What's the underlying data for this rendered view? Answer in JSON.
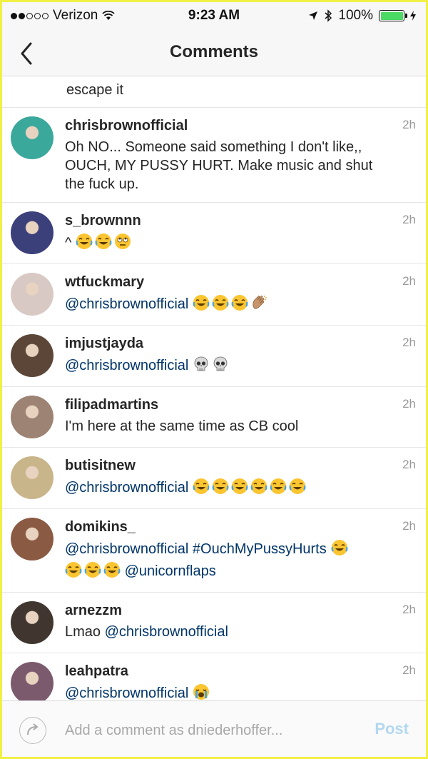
{
  "status_bar": {
    "carrier": "Verizon",
    "time": "9:23 AM",
    "battery": "100%",
    "battery_level": 1.0
  },
  "nav": {
    "title": "Comments"
  },
  "partial_comment": {
    "text": "escape it"
  },
  "comments": [
    {
      "username": "chrisbrownofficial",
      "text": "Oh NO... Someone said something I don't like,, OUCH, MY PUSSY HURT. Make music and shut the fuck up.",
      "time": "2h",
      "avatar_color": "#3aa89b"
    },
    {
      "username": "s_brownnn",
      "text": "^",
      "emojis": [
        "joy",
        "joy",
        "eye-roll"
      ],
      "time": "2h",
      "avatar_color": "#3b3f7a"
    },
    {
      "username": "wtfuckmary",
      "mention": "@chrisbrownofficial",
      "emojis": [
        "joy",
        "joy",
        "joy",
        "clap"
      ],
      "time": "2h",
      "avatar_color": "#d8c9c4"
    },
    {
      "username": "imjustjayda",
      "mention": "@chrisbrownofficial",
      "emojis": [
        "skull",
        "skull"
      ],
      "time": "2h",
      "avatar_color": "#5b4638"
    },
    {
      "username": "filipadmartins",
      "text": "I'm here at the same time as CB cool",
      "time": "2h",
      "avatar_color": "#9c8373"
    },
    {
      "username": "butisitnew",
      "mention": "@chrisbrownofficial",
      "emojis": [
        "joy",
        "joy",
        "joy",
        "joy",
        "joy",
        "joy"
      ],
      "time": "2h",
      "avatar_color": "#c9b58a"
    },
    {
      "username": "domikins_",
      "mention": "@chrisbrownofficial",
      "hashtag": "#OuchMyPussyHurts",
      "emojis": [
        "joy"
      ],
      "emojis_line2": [
        "joy",
        "joy",
        "joy"
      ],
      "mention2": "@unicornflaps",
      "time": "2h",
      "avatar_color": "#8a5a43"
    },
    {
      "username": "arnezzm",
      "prefix": "Lmao",
      "mention": "@chrisbrownofficial",
      "time": "2h",
      "avatar_color": "#40362f"
    },
    {
      "username": "leahpatra",
      "mention": "@chrisbrownofficial",
      "emojis": [
        "sob"
      ],
      "time": "2h",
      "avatar_color": "#7c5a6e"
    }
  ],
  "input": {
    "placeholder": "Add a comment as dniederhoffer...",
    "post_label": "Post"
  }
}
